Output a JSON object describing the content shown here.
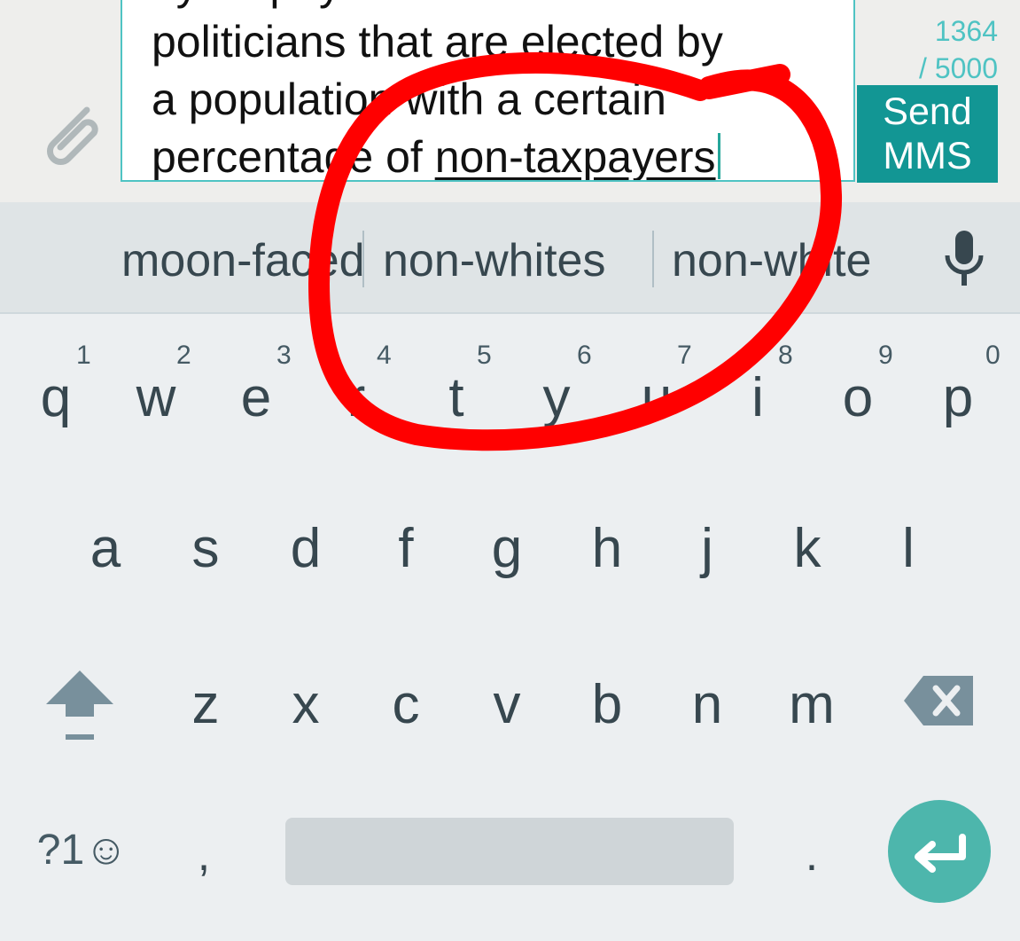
{
  "compose": {
    "message_lines_plain": "politicians that are elected by\na population with a certain\npercentage of ",
    "message_partial_top": "by taxpayers to",
    "message_underlined_word": "non-taxpayers",
    "char_count": "1364",
    "char_limit": "/ 5000",
    "send_label_line1": "Send",
    "send_label_line2": "MMS",
    "attach_icon": "paperclip-icon"
  },
  "suggestions": {
    "items": [
      "moon-faced",
      "non-whites",
      "non-white"
    ],
    "mic_icon": "microphone-icon"
  },
  "keyboard": {
    "row1": [
      {
        "key": "q",
        "hint": "1"
      },
      {
        "key": "w",
        "hint": "2"
      },
      {
        "key": "e",
        "hint": "3"
      },
      {
        "key": "r",
        "hint": "4"
      },
      {
        "key": "t",
        "hint": "5"
      },
      {
        "key": "y",
        "hint": "6"
      },
      {
        "key": "u",
        "hint": "7"
      },
      {
        "key": "i",
        "hint": "8"
      },
      {
        "key": "o",
        "hint": "9"
      },
      {
        "key": "p",
        "hint": "0"
      }
    ],
    "row2": [
      "a",
      "s",
      "d",
      "f",
      "g",
      "h",
      "j",
      "k",
      "l"
    ],
    "row3": [
      "z",
      "x",
      "c",
      "v",
      "b",
      "n",
      "m"
    ],
    "symbols_label": "?1☺",
    "comma": ",",
    "period": ".",
    "shift_icon": "shift-icon",
    "backspace_icon": "backspace-icon",
    "enter_icon": "enter-icon"
  },
  "colors": {
    "accent": "#129694",
    "counter": "#4fc3c3",
    "enter_bg": "#4db6ac",
    "annotation": "#ff0000",
    "key_text": "#37474f"
  },
  "annotation": {
    "type": "hand-drawn red circle with arrow"
  }
}
